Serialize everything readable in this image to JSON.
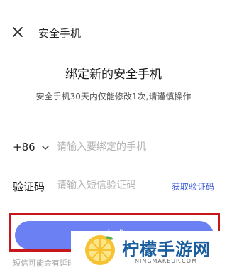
{
  "topbar": {
    "close_icon": "close-icon",
    "title": "安全手机"
  },
  "heading": "绑定新的安全手机",
  "subheading": "安全手机30天内仅能修改1次,请谨慎操作",
  "phone_row": {
    "country_code": "+86",
    "chevron_icon": "chevron-down-icon",
    "placeholder": "请输入要绑定的手机",
    "value": ""
  },
  "code_row": {
    "label": "验证码",
    "placeholder": "请输入短信验证码",
    "value": "",
    "get_code_label": "获取验证码"
  },
  "done_button": {
    "label": "完成"
  },
  "footnote": "短信可能会有延时，请",
  "watermark": {
    "title": "柠檬手游网",
    "subtitle": "NINGMAKEUP.COM"
  },
  "colors": {
    "accent": "#6b80f2",
    "link": "#3d5bd9",
    "highlight_border": "#c8171b",
    "watermark_text": "#1b5e9e"
  }
}
